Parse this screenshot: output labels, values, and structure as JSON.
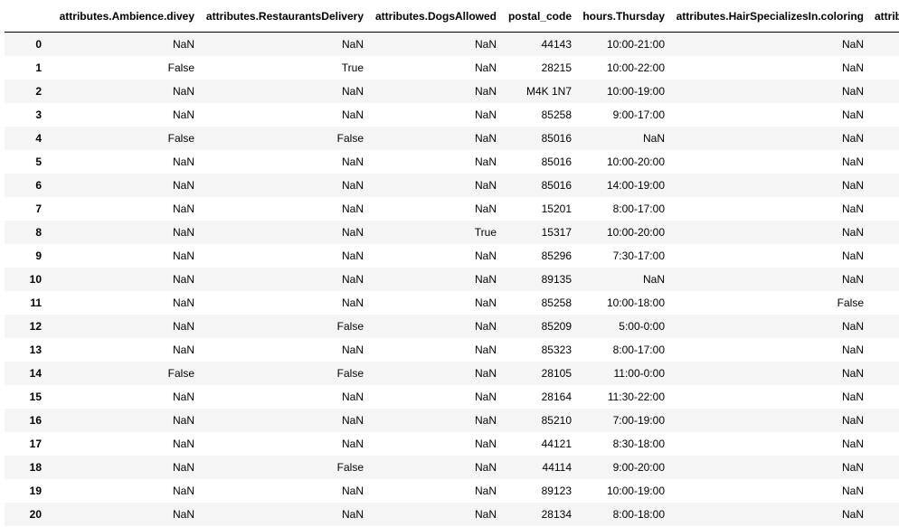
{
  "table": {
    "columns": [
      "",
      "attributes.Ambience.divey",
      "attributes.RestaurantsDelivery",
      "attributes.DogsAllowed",
      "postal_code",
      "hours.Thursday",
      "attributes.HairSpecializesIn.coloring",
      "attrib"
    ],
    "rows": [
      [
        "0",
        "NaN",
        "NaN",
        "NaN",
        "44143",
        "10:00-21:00",
        "NaN"
      ],
      [
        "1",
        "False",
        "True",
        "NaN",
        "28215",
        "10:00-22:00",
        "NaN"
      ],
      [
        "2",
        "NaN",
        "NaN",
        "NaN",
        "M4K 1N7",
        "10:00-19:00",
        "NaN"
      ],
      [
        "3",
        "NaN",
        "NaN",
        "NaN",
        "85258",
        "9:00-17:00",
        "NaN"
      ],
      [
        "4",
        "False",
        "False",
        "NaN",
        "85016",
        "NaN",
        "NaN"
      ],
      [
        "5",
        "NaN",
        "NaN",
        "NaN",
        "85016",
        "10:00-20:00",
        "NaN"
      ],
      [
        "6",
        "NaN",
        "NaN",
        "NaN",
        "85016",
        "14:00-19:00",
        "NaN"
      ],
      [
        "7",
        "NaN",
        "NaN",
        "NaN",
        "15201",
        "8:00-17:00",
        "NaN"
      ],
      [
        "8",
        "NaN",
        "NaN",
        "True",
        "15317",
        "10:00-20:00",
        "NaN"
      ],
      [
        "9",
        "NaN",
        "NaN",
        "NaN",
        "85296",
        "7:30-17:00",
        "NaN"
      ],
      [
        "10",
        "NaN",
        "NaN",
        "NaN",
        "89135",
        "NaN",
        "NaN"
      ],
      [
        "11",
        "NaN",
        "NaN",
        "NaN",
        "85258",
        "10:00-18:00",
        "False"
      ],
      [
        "12",
        "NaN",
        "False",
        "NaN",
        "85209",
        "5:00-0:00",
        "NaN"
      ],
      [
        "13",
        "NaN",
        "NaN",
        "NaN",
        "85323",
        "8:00-17:00",
        "NaN"
      ],
      [
        "14",
        "False",
        "False",
        "NaN",
        "28105",
        "11:00-0:00",
        "NaN"
      ],
      [
        "15",
        "NaN",
        "NaN",
        "NaN",
        "28164",
        "11:30-22:00",
        "NaN"
      ],
      [
        "16",
        "NaN",
        "NaN",
        "NaN",
        "85210",
        "7:00-19:00",
        "NaN"
      ],
      [
        "17",
        "NaN",
        "NaN",
        "NaN",
        "44121",
        "8:30-18:00",
        "NaN"
      ],
      [
        "18",
        "NaN",
        "False",
        "NaN",
        "44114",
        "9:00-20:00",
        "NaN"
      ],
      [
        "19",
        "NaN",
        "NaN",
        "NaN",
        "89123",
        "10:00-19:00",
        "NaN"
      ],
      [
        "20",
        "NaN",
        "NaN",
        "NaN",
        "28134",
        "8:00-18:00",
        "NaN"
      ]
    ]
  },
  "colors": {
    "row_stripe": "#f5f5f5",
    "header_border": "#000000"
  }
}
